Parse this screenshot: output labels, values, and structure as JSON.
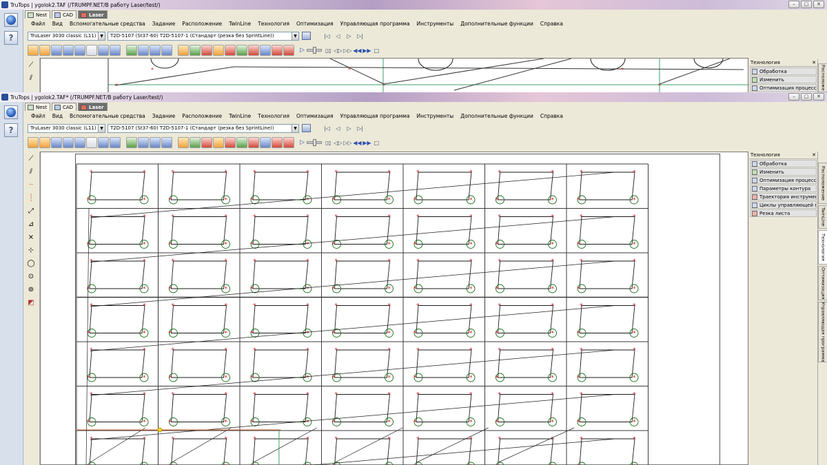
{
  "window_top": {
    "title": "TruTops | ygolok2.TAF (/TRUMPF.NET/В работу Laser/test/)",
    "tabs": [
      {
        "label": "Nest"
      },
      {
        "label": "CAD"
      },
      {
        "label": "Laser"
      }
    ],
    "menu": [
      "Файл",
      "Вид",
      "Вспомогательные средства",
      "Задание",
      "Расположение",
      "TwinLine",
      "Технология",
      "Оптимизация",
      "Управляющая программа",
      "Инструменты",
      "Дополнительные функции",
      "Справка"
    ],
    "machine": "TruLaser 3030 classic (L11)",
    "material": "T2D-5107 (St37-60) T2D-5107-1 (Стандарт (резка без SprintLine))",
    "panel": {
      "title": "Технология",
      "items": [
        "Обработка",
        "Изменить",
        "Оптимизация процесса"
      ]
    },
    "vtab": "Расположе"
  },
  "window_main": {
    "title": "TruTops | ygolok2.TAF* (/TRUMPF.NET/В работу Laser/test/)",
    "tabs": [
      {
        "label": "Nest"
      },
      {
        "label": "CAD"
      },
      {
        "label": "Laser"
      }
    ],
    "menu": [
      "Файл",
      "Вид",
      "Вспомогательные средства",
      "Задание",
      "Расположение",
      "TwinLine",
      "Технология",
      "Оптимизация",
      "Управляющая программа",
      "Инструменты",
      "Дополнительные функции",
      "Справка"
    ],
    "machine": "TruLaser 3030 classic (L11)",
    "material": "T2D-5107 (St37-60) T2D-5107-1 (Стандарт (резка без SprintLine))",
    "panel": {
      "title": "Технология",
      "items": [
        "Обработка",
        "Изменить",
        "Оптимизация процесса",
        "Параметры контура",
        "Траектория инструмента",
        "Циклы управляющей программы",
        "Резка листа"
      ]
    },
    "vtabs": [
      "Расположение",
      "TwinLine",
      "Технология",
      "Оптимизация",
      "Управляющая программа"
    ],
    "active_vtab": "Технология"
  },
  "nest": {
    "columns": 7,
    "rows": 7
  },
  "icons": {
    "globe": "globe-icon",
    "help": "help-icon",
    "close": "close-icon",
    "minimize": "minimize-icon",
    "maximize": "maximize-icon"
  },
  "colors": {
    "part_contour": "#1a1a1a",
    "lead_in": "#1a6b1a",
    "pierce_marker": "#d42020",
    "grid_line": "#3b3b3b",
    "traverse": "#3a5aa0"
  }
}
